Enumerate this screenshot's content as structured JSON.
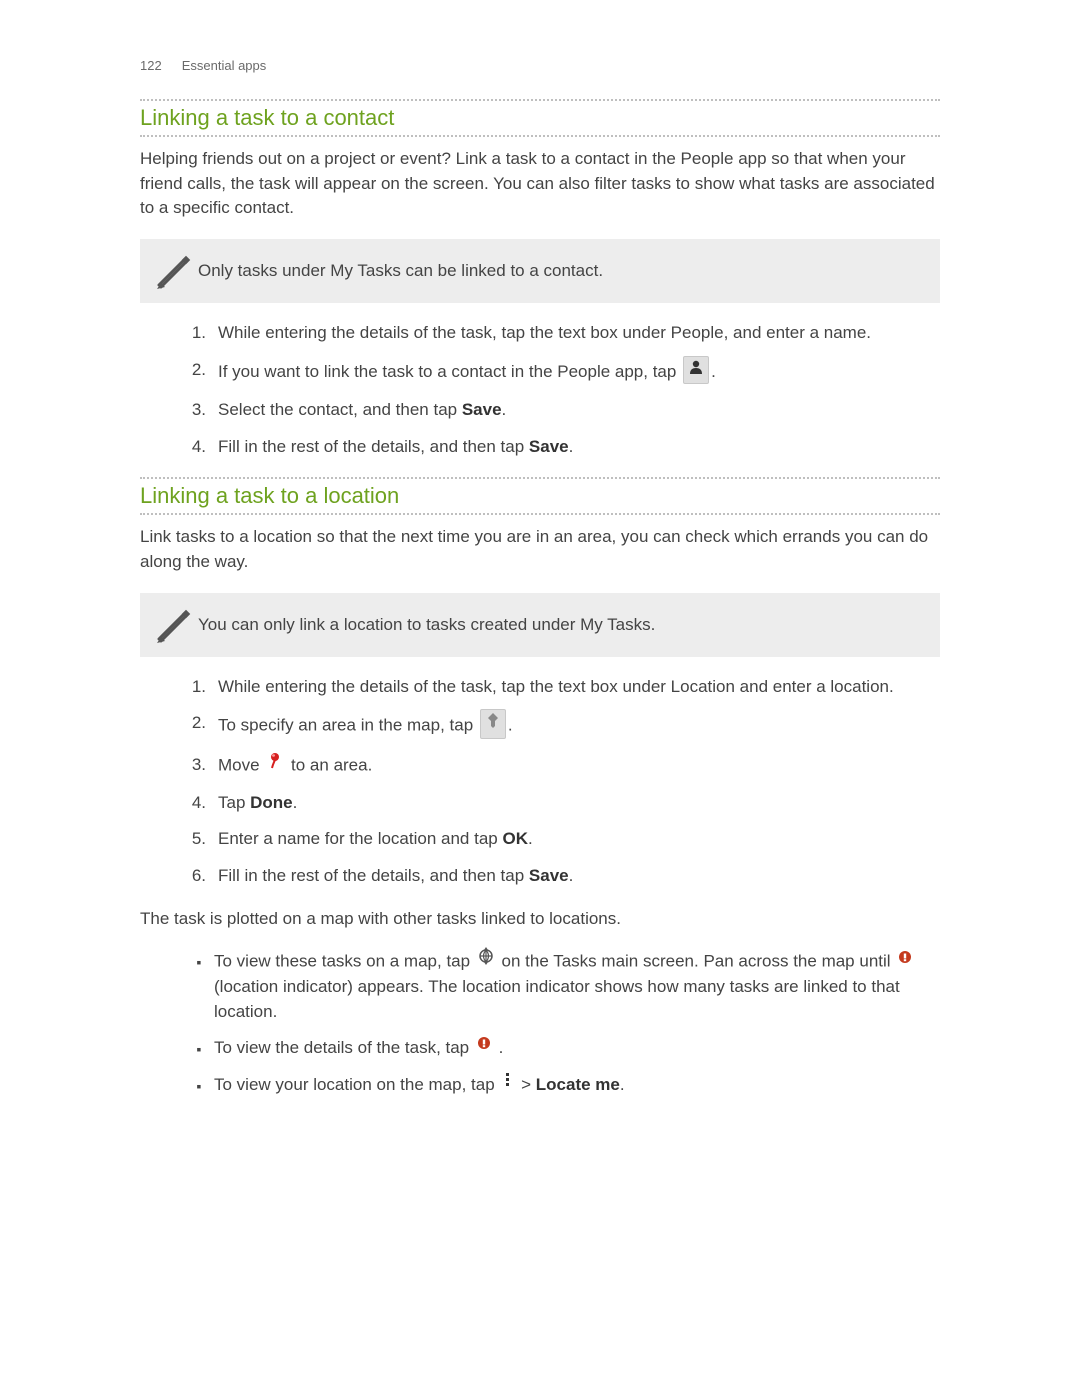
{
  "header": {
    "page_number": "122",
    "chapter": "Essential apps"
  },
  "section1": {
    "title": "Linking a task to a contact",
    "intro": "Helping friends out on a project or event? Link a task to a contact in the People app so that when your friend calls, the task will appear on the screen. You can also filter tasks to show what tasks are associated to a specific contact.",
    "note": "Only tasks under My Tasks can be linked to a contact.",
    "step1": "While entering the details of the task, tap the text box under People, and enter a name.",
    "step2_pre": "If you want to link the task to a contact in the People app, tap ",
    "step2_post": ".",
    "step3_pre": "Select the contact, and then tap ",
    "step3_bold": "Save",
    "step3_post": ".",
    "step4_pre": "Fill in the rest of the details, and then tap ",
    "step4_bold": "Save",
    "step4_post": "."
  },
  "section2": {
    "title": "Linking a task to a location",
    "intro": "Link tasks to a location so that the next time you are in an area, you can check which errands you can do along the way.",
    "note": "You can only link a location to tasks created under My Tasks.",
    "step1": "While entering the details of the task, tap the text box under Location and enter a location.",
    "step2_pre": "To specify an area in the map, tap ",
    "step2_post": ".",
    "step3_pre": "Move ",
    "step3_post": " to an area.",
    "step4_pre": "Tap ",
    "step4_bold": "Done",
    "step4_post": ".",
    "step5_pre": "Enter a name for the location and tap ",
    "step5_bold": "OK",
    "step5_post": ".",
    "step6_pre": "Fill in the rest of the details, and then tap ",
    "step6_bold": "Save",
    "step6_post": ".",
    "after": "The task is plotted on a map with other tasks linked to locations.",
    "bullet1_pre": "To view these tasks on a map, tap ",
    "bullet1_mid": " on the Tasks main screen. Pan across the map until ",
    "bullet1_post": " (location indicator) appears. The location indicator shows how many tasks are linked to that location.",
    "bullet2_pre": "To view the details of the task, tap ",
    "bullet2_post": ".",
    "bullet3_pre": "To view your location on the map, tap ",
    "bullet3_gt": " > ",
    "bullet3_bold": "Locate me",
    "bullet3_post": "."
  },
  "marks": {
    "n1": "1.",
    "n2": "2.",
    "n3": "3.",
    "n4": "4.",
    "n5": "5.",
    "n6": "6.",
    "bullet": "▪"
  }
}
